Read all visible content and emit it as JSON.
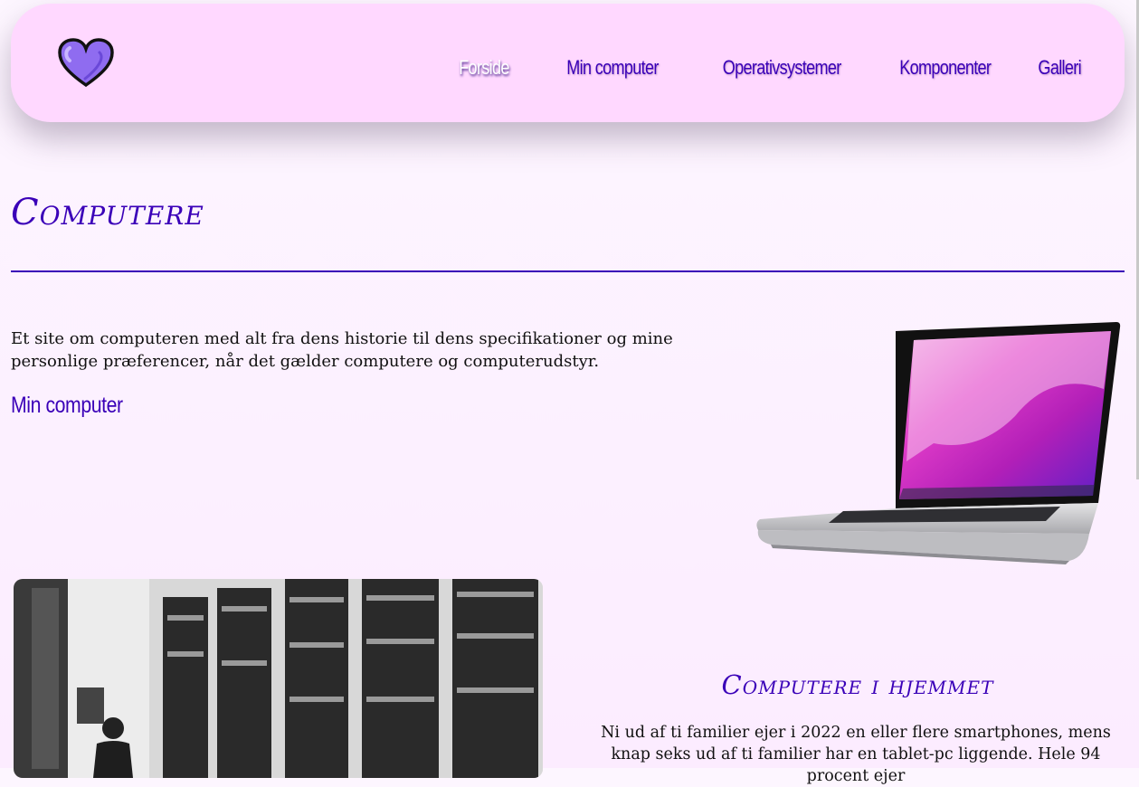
{
  "header": {
    "logo_icon": "heart-icon",
    "nav": [
      "Forside",
      "Min computer",
      "Operativsystemer",
      "Komponenter",
      "Galleri"
    ],
    "active_nav": "Forside"
  },
  "main": {
    "title": "Computere",
    "intro": "Et site om computeren med alt fra dens historie til dens specifikationer og mine personlige præferencer, når det gælder computere og computerudstyr.",
    "subheading": "Min computer"
  },
  "home_section": {
    "title": "Computere i hjemmet",
    "text": "Ni ud af ti familier ejer i 2022 en eller flere smartphones, mens knap seks ud af ti familier har en tablet-pc liggende. Hele 94 procent ejer"
  },
  "colors": {
    "accent": "#3a00b8",
    "header_bg": "#ffd8ff",
    "heart": "#8f6cf0"
  }
}
